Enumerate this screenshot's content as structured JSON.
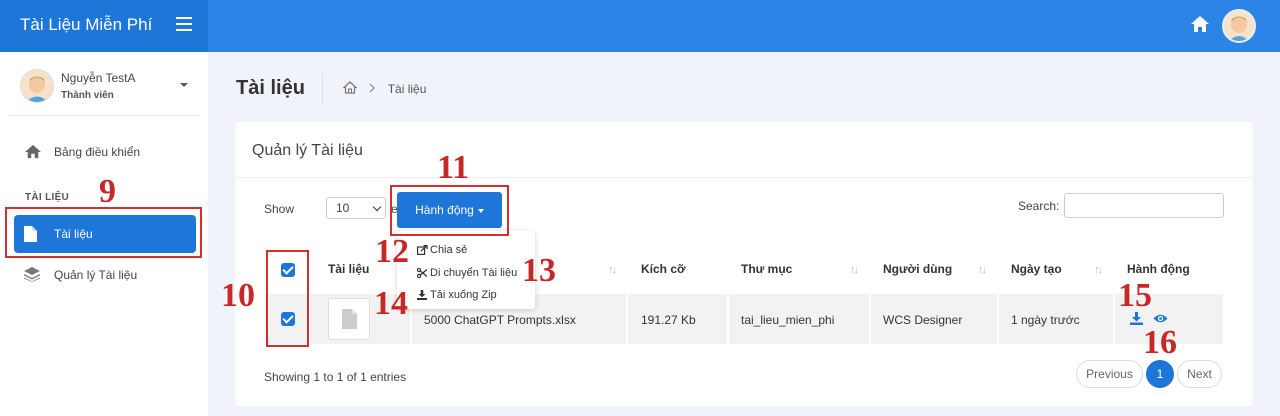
{
  "header": {
    "brand": "Tài Liệu Miễn Phí"
  },
  "sidebar": {
    "user_name": "Nguyễn TestA",
    "user_role": "Thành viên",
    "dashboard": "Bảng điều khiển",
    "section": "TÀI LIỆU",
    "docs": "Tài liệu",
    "manage": "Quản lý Tài liệu"
  },
  "page": {
    "title": "Tài liệu",
    "breadcrumb": "Tài liệu"
  },
  "card": {
    "title": "Quản lý Tài liệu",
    "show_label": "Show",
    "show_value": "10",
    "entries_label": "entries",
    "action_button": "Hành động",
    "search_label": "Search:",
    "search_value": ""
  },
  "dropdown": {
    "share": "Chia sẻ",
    "move": "Di chuyển Tài liệu",
    "zip": "Tải xuống Zip"
  },
  "table": {
    "headers": {
      "doc": "Tài liệu",
      "size": "Kích cỡ",
      "folder": "Thư mục",
      "user": "Người dùng",
      "date": "Ngày tạo",
      "actions": "Hành động"
    },
    "row": {
      "name": "5000 ChatGPT Prompts.xlsx",
      "size": "191.27 Kb",
      "folder": "tai_lieu_mien_phi",
      "user": "WCS Designer",
      "date": "1 ngày trước"
    }
  },
  "footer": {
    "showing": "Showing 1 to 1 of 1 entries",
    "prev": "Previous",
    "page": "1",
    "next": "Next"
  },
  "annotations": [
    "9",
    "10",
    "11",
    "12",
    "13",
    "14",
    "15",
    "16"
  ],
  "colors": {
    "primary": "#1e76d9",
    "topbar": "#2b84e6",
    "annotation": "#d32f2f"
  }
}
